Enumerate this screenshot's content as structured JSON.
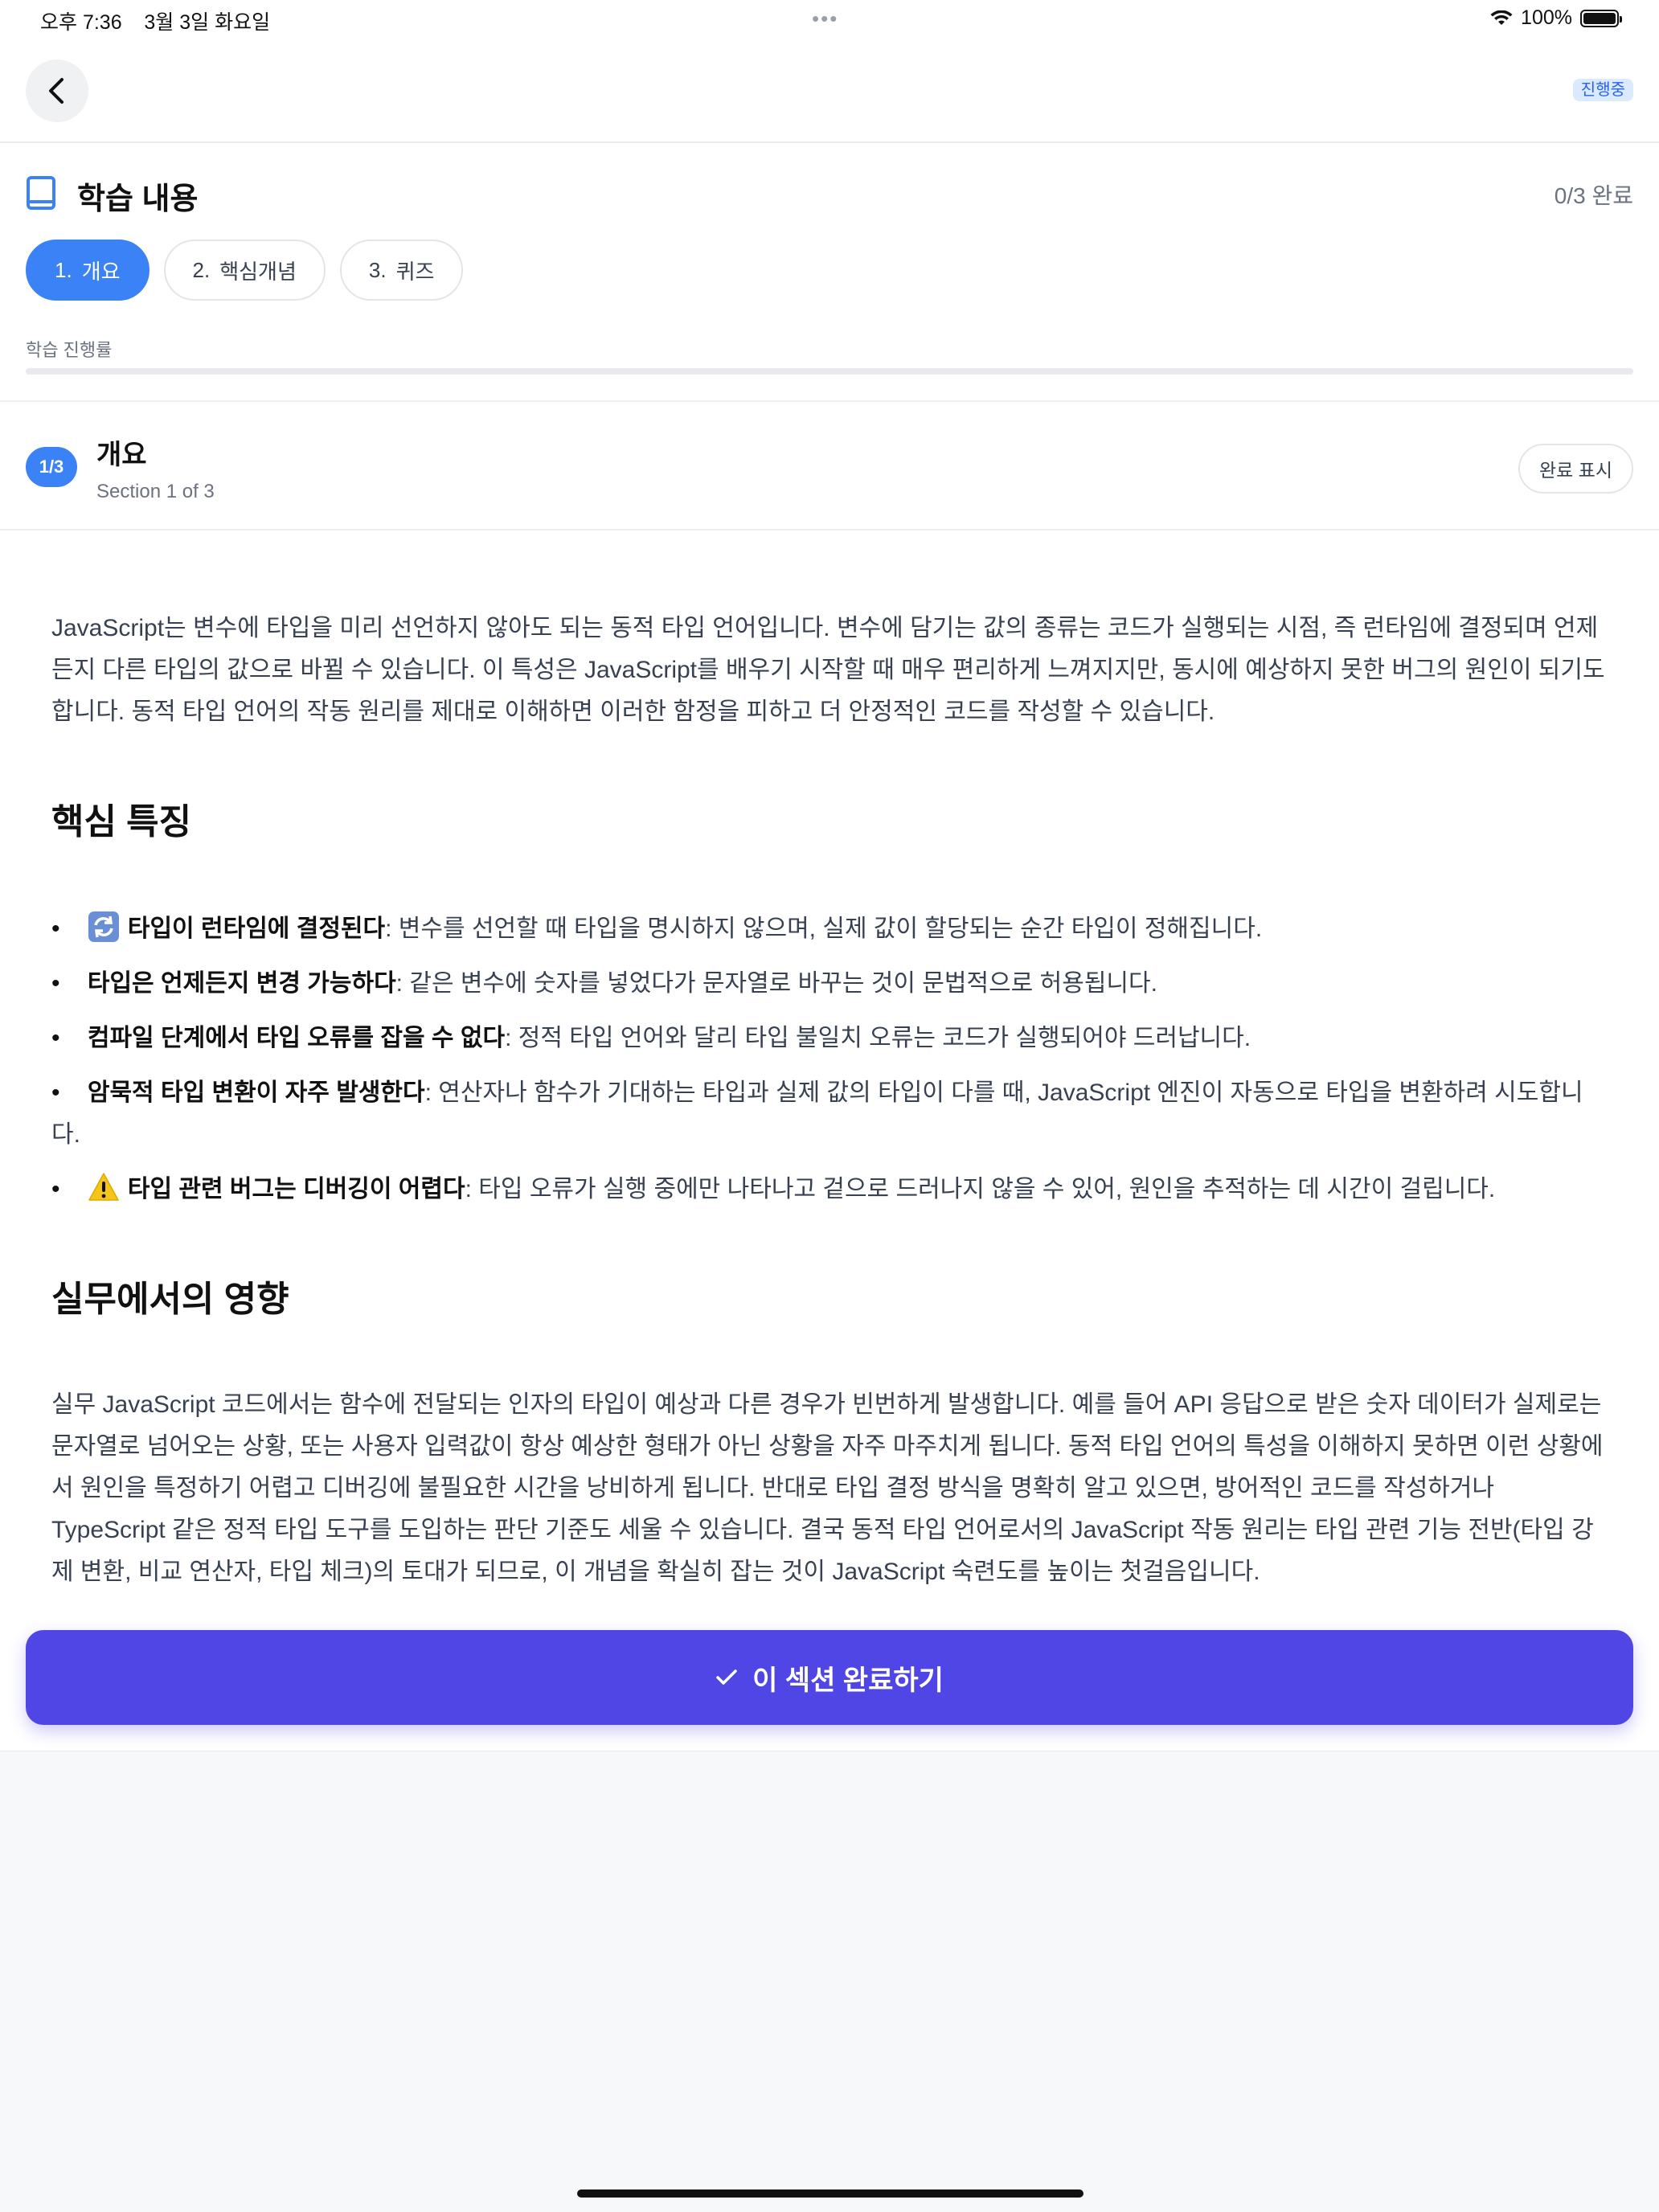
{
  "status_bar": {
    "time": "오후 7:36",
    "date": "3월 3일 화요일",
    "dots": "•••",
    "battery": "100%"
  },
  "header": {
    "status_badge": "진행중"
  },
  "learning": {
    "title": "학습 내용",
    "progress_count": "0/3 완료",
    "progress_label": "학습 진행률",
    "progress_fraction": 0,
    "tabs": [
      {
        "num": "1.",
        "label": "개요",
        "active": true
      },
      {
        "num": "2.",
        "label": "핵심개념",
        "active": false
      },
      {
        "num": "3.",
        "label": "퀴즈",
        "active": false
      }
    ]
  },
  "section": {
    "badge": "1/3",
    "title": "개요",
    "subtitle": "Section 1 of 3",
    "mark_button": "완료 표시"
  },
  "content": {
    "intro": "JavaScript는 변수에 타입을 미리 선언하지 않아도 되는 동적 타입 언어입니다. 변수에 담기는 값의 종류는 코드가 실행되는 시점, 즉 런타임에 결정되며 언제든지 다른 타입의 값으로 바뀔 수 있습니다. 이 특성은 JavaScript를 배우기 시작할 때 매우 편리하게 느껴지지만, 동시에 예상하지 못한 버그의 원인이 되기도 합니다. 동적 타입 언어의 작동 원리를 제대로 이해하면 이러한 함정을 피하고 더 안정적인 코드를 작성할 수 있습니다.",
    "heading1": "핵심 특징",
    "bullets": [
      {
        "icon": "refresh-emoji-icon",
        "bold": "타입이 런타임에 결정된다",
        "text": ": 변수를 선언할 때 타입을 명시하지 않으며, 실제 값이 할당되는 순간 타입이 정해집니다."
      },
      {
        "icon": "",
        "bold": "타입은 언제든지 변경 가능하다",
        "text": ": 같은 변수에 숫자를 넣었다가 문자열로 바꾸는 것이 문법적으로 허용됩니다."
      },
      {
        "icon": "",
        "bold": "컴파일 단계에서 타입 오류를 잡을 수 없다",
        "text": ": 정적 타입 언어와 달리 타입 불일치 오류는 코드가 실행되어야 드러납니다."
      },
      {
        "icon": "",
        "bold": "암묵적 타입 변환이 자주 발생한다",
        "text": ": 연산자나 함수가 기대하는 타입과 실제 값의 타입이 다를 때, JavaScript 엔진이 자동으로 타입을 변환하려 시도합니다."
      },
      {
        "icon": "warning-emoji-icon",
        "bold": "타입 관련 버그는 디버깅이 어렵다",
        "text": ": 타입 오류가 실행 중에만 나타나고 겉으로 드러나지 않을 수 있어, 원인을 추적하는 데 시간이 걸립니다."
      }
    ],
    "heading2": "실무에서의 영향",
    "practice": "실무 JavaScript 코드에서는 함수에 전달되는 인자의 타입이 예상과 다른 경우가 빈번하게 발생합니다. 예를 들어 API 응답으로 받은 숫자 데이터가 실제로는 문자열로 넘어오는 상황, 또는 사용자 입력값이 항상 예상한 형태가 아닌 상황을 자주 마주치게 됩니다. 동적 타입 언어의 특성을 이해하지 못하면 이런 상황에서 원인을 특정하기 어렵고 디버깅에 불필요한 시간을 낭비하게 됩니다. 반대로 타입 결정 방식을 명확히 알고 있으면, 방어적인 코드를 작성하거나 TypeScript 같은 정적 타입 도구를 도입하는 판단 기준도 세울 수 있습니다. 결국 동적 타입 언어로서의 JavaScript 작동 원리는 타입 관련 기능 전반(타입 강제 변환, 비교 연산자, 타입 체크)의 토대가 되므로, 이 개념을 확실히 잡는 것이 JavaScript 숙련도를 높이는 첫걸음입니다."
  },
  "footer": {
    "complete_button": "이 섹션 완료하기"
  },
  "colors": {
    "primary_blue": "#3b82f6",
    "complete_purple": "#4f46e5",
    "badge_bg": "#dbeafe"
  }
}
